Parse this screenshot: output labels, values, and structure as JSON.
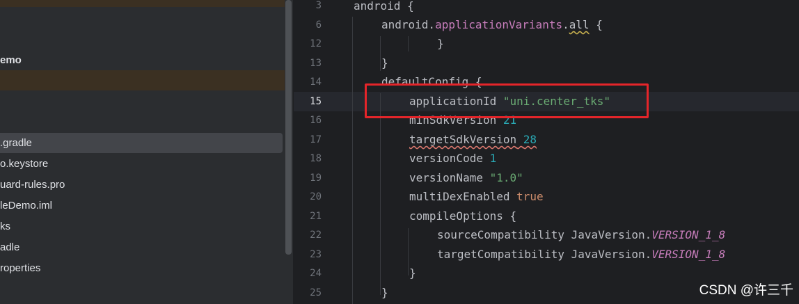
{
  "project_tree": {
    "items": [
      {
        "label": "emo",
        "bold": true
      },
      {
        "label": ".gradle",
        "selected": true
      },
      {
        "label": "o.keystore"
      },
      {
        "label": "uard-rules.pro"
      },
      {
        "label": "leDemo.iml"
      },
      {
        "label": "ks"
      },
      {
        "label": "adle"
      },
      {
        "label": "roperties"
      }
    ]
  },
  "editor": {
    "line_numbers": [
      "3",
      "6",
      "12",
      "13",
      "14",
      "15",
      "16",
      "17",
      "18",
      "19",
      "20",
      "21",
      "22",
      "23",
      "24",
      "25"
    ],
    "current_line": "15",
    "lines": {
      "l3": {
        "kw": "android",
        "rest": " {"
      },
      "l6": {
        "a": "android.",
        "b": "applicationVariants",
        "c": ".",
        "d": "all",
        "e": " {"
      },
      "l12": {
        "text": "}"
      },
      "l13": {
        "text": "}"
      },
      "l14": {
        "text": "defaultConfig {"
      },
      "l15": {
        "key": "applicationId ",
        "value": "\"uni.center_tks\""
      },
      "l16": {
        "key": "minSdkVersion ",
        "value": "21"
      },
      "l17": {
        "key": "targetSdkVersion",
        "sp": " ",
        "value": "28"
      },
      "l18": {
        "key": "versionCode ",
        "value": "1"
      },
      "l19": {
        "key": "versionName ",
        "value": "\"1.0\""
      },
      "l20": {
        "key": "multiDexEnabled ",
        "value": "true"
      },
      "l21": {
        "text": "compileOptions {"
      },
      "l22": {
        "key": "sourceCompatibility JavaVersion.",
        "value": "VERSION_1_8"
      },
      "l23": {
        "key": "targetCompatibility JavaVersion.",
        "value": "VERSION_1_8"
      },
      "l24": {
        "text": "}"
      },
      "l25": {
        "text": "}"
      }
    }
  },
  "watermark": "CSDN @许三千",
  "colors": {
    "annotation_box": "#e5252a",
    "string": "#6aab73",
    "number": "#2aacb8",
    "keyword": "#cf8e6d"
  }
}
